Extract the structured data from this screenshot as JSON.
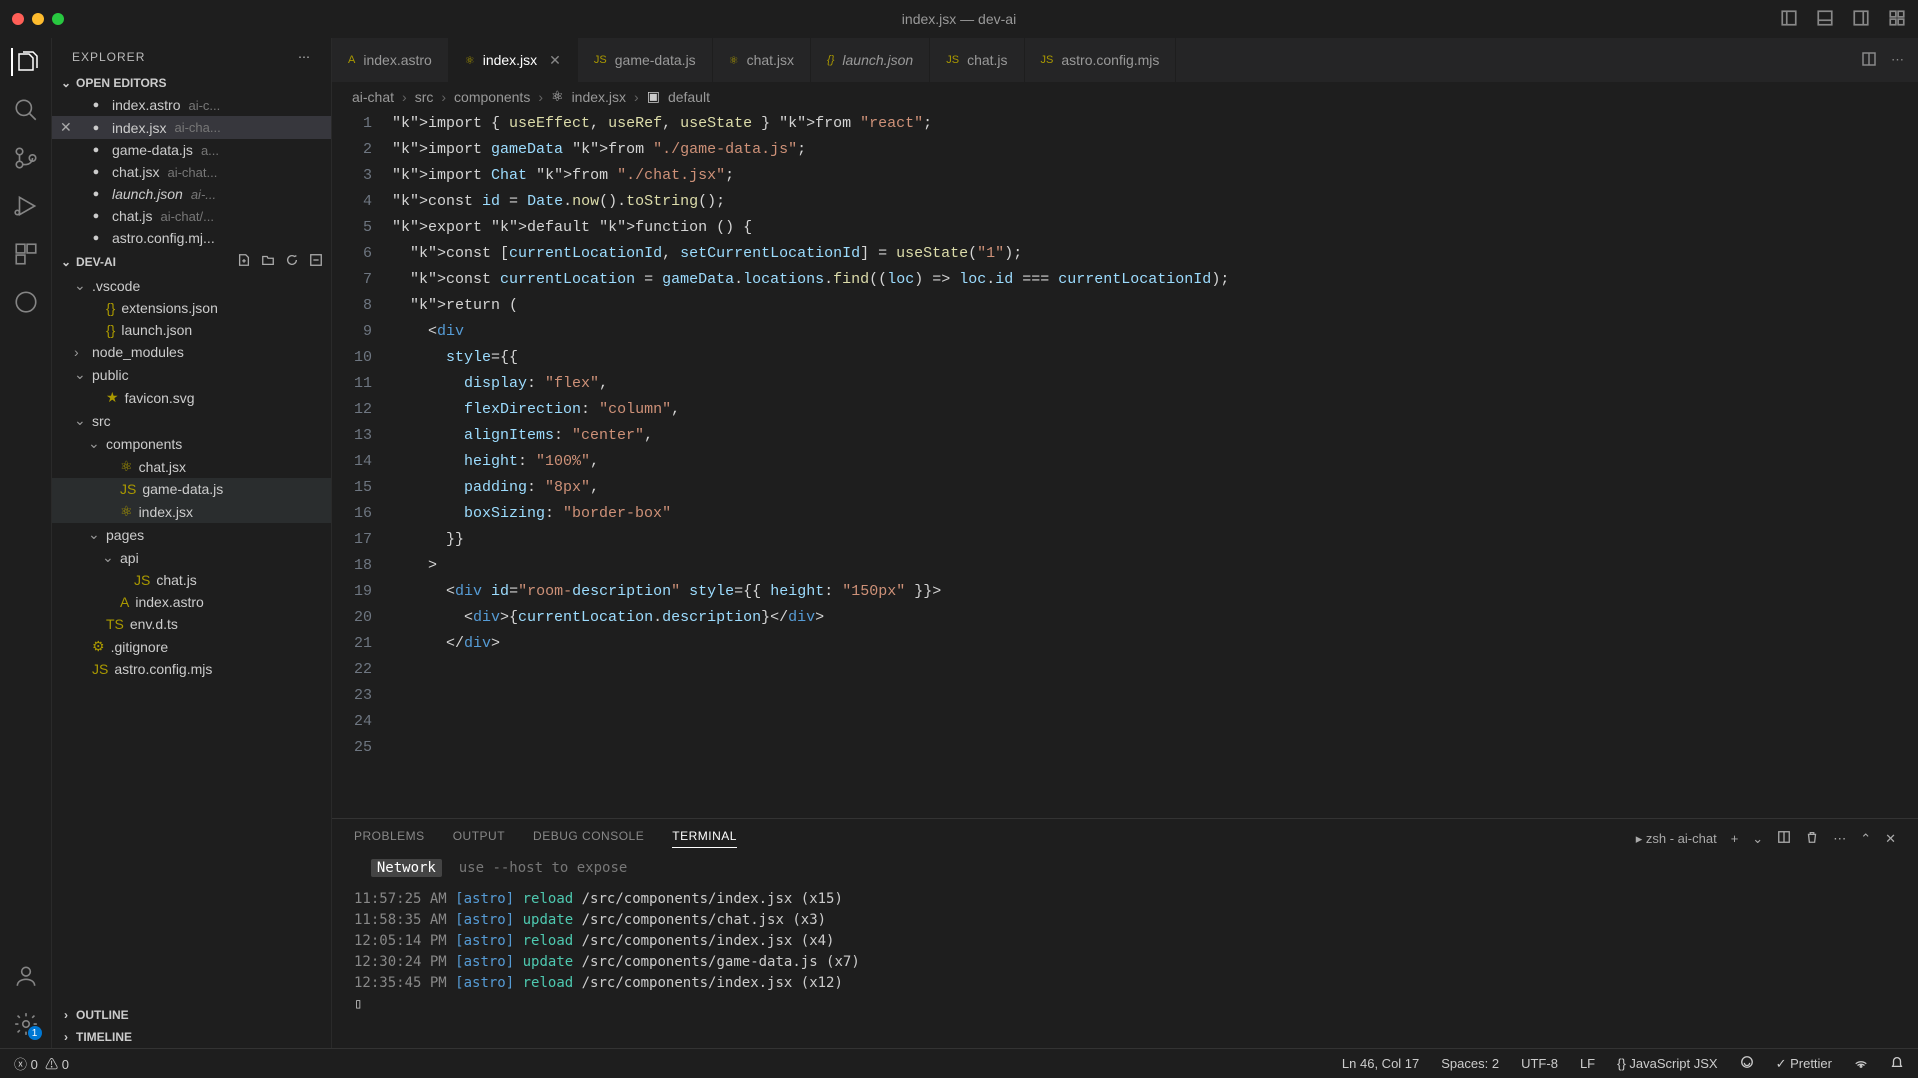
{
  "window": {
    "title": "index.jsx — dev-ai"
  },
  "sidebar": {
    "title": "EXPLORER",
    "open_editors_label": "OPEN EDITORS",
    "open_editors": [
      {
        "name": "index.astro",
        "hint": "ai-c..."
      },
      {
        "name": "index.jsx",
        "hint": "ai-cha...",
        "active": true
      },
      {
        "name": "game-data.js",
        "hint": "a..."
      },
      {
        "name": "chat.jsx",
        "hint": "ai-chat..."
      },
      {
        "name": "launch.json",
        "hint": "ai-...",
        "italic": true
      },
      {
        "name": "chat.js",
        "hint": "ai-chat/..."
      },
      {
        "name": "astro.config.mj...",
        "hint": ""
      }
    ],
    "project_label": "DEV-AI",
    "tree": [
      {
        "depth": 1,
        "chev": "v",
        "name": ".vscode"
      },
      {
        "depth": 2,
        "icon": "{}",
        "name": "extensions.json"
      },
      {
        "depth": 2,
        "icon": "{}",
        "name": "launch.json"
      },
      {
        "depth": 1,
        "chev": ">",
        "name": "node_modules"
      },
      {
        "depth": 1,
        "chev": "v",
        "name": "public"
      },
      {
        "depth": 2,
        "icon": "★",
        "name": "favicon.svg"
      },
      {
        "depth": 1,
        "chev": "v",
        "name": "src"
      },
      {
        "depth": 2,
        "chev": "v",
        "name": "components"
      },
      {
        "depth": 3,
        "icon": "⚛",
        "name": "chat.jsx"
      },
      {
        "depth": 3,
        "icon": "JS",
        "name": "game-data.js",
        "sel": true
      },
      {
        "depth": 3,
        "icon": "⚛",
        "name": "index.jsx",
        "sel": true
      },
      {
        "depth": 2,
        "chev": "v",
        "name": "pages"
      },
      {
        "depth": 3,
        "chev": "v",
        "name": "api"
      },
      {
        "depth": 4,
        "icon": "JS",
        "name": "chat.js"
      },
      {
        "depth": 3,
        "icon": "A",
        "name": "index.astro"
      },
      {
        "depth": 2,
        "icon": "TS",
        "name": "env.d.ts"
      },
      {
        "depth": 1,
        "icon": "⚙",
        "name": ".gitignore"
      },
      {
        "depth": 1,
        "icon": "JS",
        "name": "astro.config.mjs"
      }
    ],
    "outline_label": "OUTLINE",
    "timeline_label": "TIMELINE"
  },
  "tabs": [
    {
      "icon": "A",
      "name": "index.astro"
    },
    {
      "icon": "⚛",
      "name": "index.jsx",
      "active": true,
      "close": true
    },
    {
      "icon": "JS",
      "name": "game-data.js"
    },
    {
      "icon": "⚛",
      "name": "chat.jsx"
    },
    {
      "icon": "{}",
      "name": "launch.json",
      "italic": true
    },
    {
      "icon": "JS",
      "name": "chat.js"
    },
    {
      "icon": "JS",
      "name": "astro.config.mjs"
    }
  ],
  "breadcrumb": [
    "ai-chat",
    "src",
    "components",
    "index.jsx",
    "default"
  ],
  "code_lines": [
    "import { useEffect, useRef, useState } from \"react\";",
    "import gameData from \"./game-data.js\";",
    "import Chat from \"./chat.jsx\";",
    "",
    "const id = Date.now().toString();",
    "",
    "export default function () {",
    "  const [currentLocationId, setCurrentLocationId] = useState(\"1\");",
    "",
    "  const currentLocation = gameData.locations.find((loc) => loc.id === currentLocationId);",
    "",
    "  return (",
    "    <div",
    "      style={{",
    "        display: \"flex\",",
    "        flexDirection: \"column\",",
    "        alignItems: \"center\",",
    "        height: \"100%\",",
    "        padding: \"8px\",",
    "        boxSizing: \"border-box\"",
    "      }}",
    "    >",
    "      <div id=\"room-description\" style={{ height: \"150px\" }}>",
    "        <div>{currentLocation.description}</div>",
    "      </div>"
  ],
  "panel": {
    "tabs": [
      "PROBLEMS",
      "OUTPUT",
      "DEBUG CONSOLE",
      "TERMINAL"
    ],
    "active_tab": 3,
    "shell": "zsh - ai-chat",
    "network_label": "Network",
    "network_hint": "use --host to expose",
    "lines": [
      {
        "ts": "11:57:25 AM",
        "tag": "[astro]",
        "act": "reload",
        "path": "/src/components/index.jsx (x15)"
      },
      {
        "ts": "11:58:35 AM",
        "tag": "[astro]",
        "act": "update",
        "path": "/src/components/chat.jsx (x3)"
      },
      {
        "ts": "12:05:14 PM",
        "tag": "[astro]",
        "act": "reload",
        "path": "/src/components/index.jsx (x4)"
      },
      {
        "ts": "12:30:24 PM",
        "tag": "[astro]",
        "act": "update",
        "path": "/src/components/game-data.js (x7)"
      },
      {
        "ts": "12:35:45 PM",
        "tag": "[astro]",
        "act": "reload",
        "path": "/src/components/index.jsx (x12)"
      }
    ]
  },
  "status": {
    "errors": "0",
    "warnings": "0",
    "cursor": "Ln 46, Col 17",
    "spaces": "Spaces: 2",
    "encoding": "UTF-8",
    "eol": "LF",
    "lang_icon": "{}",
    "lang": "JavaScript JSX",
    "prettier": "Prettier"
  }
}
